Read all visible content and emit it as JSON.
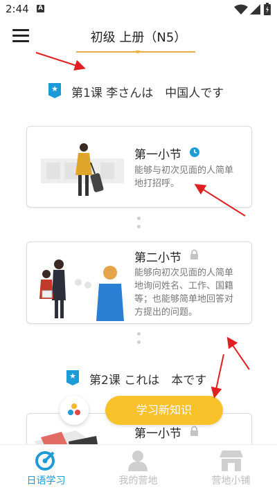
{
  "status": {
    "time": "2:44",
    "app_icon_letter": "A"
  },
  "header": {
    "title": "初级 上册（N5）"
  },
  "lessons": [
    {
      "badge_icon": "star-badge-icon",
      "title": "第1课 李さんは　中国人です"
    },
    {
      "badge_icon": "star-badge-icon",
      "title": "第2课 これは　本です"
    }
  ],
  "sections": [
    {
      "title": "第一小节",
      "status_icon": "clock-icon",
      "desc": [
        "能够与初次见面的人简单",
        "地打招呼。"
      ]
    },
    {
      "title": "第二小节",
      "status_icon": "lock-icon",
      "desc": [
        "能够向初次见面的人简单",
        "地询问姓名、工作、国籍",
        "等；也能够简单地回答对",
        "方提出的问题。"
      ]
    },
    {
      "title": "第一小节",
      "status_icon": "lock-icon",
      "desc": []
    }
  ],
  "actions": {
    "learn_new": "学习新知识"
  },
  "tabs": [
    {
      "label": "日语学习",
      "icon": "japanese-study-icon",
      "active": true
    },
    {
      "label": "我的营地",
      "icon": "profile-icon",
      "active": false
    },
    {
      "label": "营地小铺",
      "icon": "shop-icon",
      "active": false
    }
  ],
  "colors": {
    "accent": "#1e9bd7",
    "button": "#f9c22b",
    "annotation_arrow": "#e02020",
    "inactive": "#c8c8c8"
  }
}
